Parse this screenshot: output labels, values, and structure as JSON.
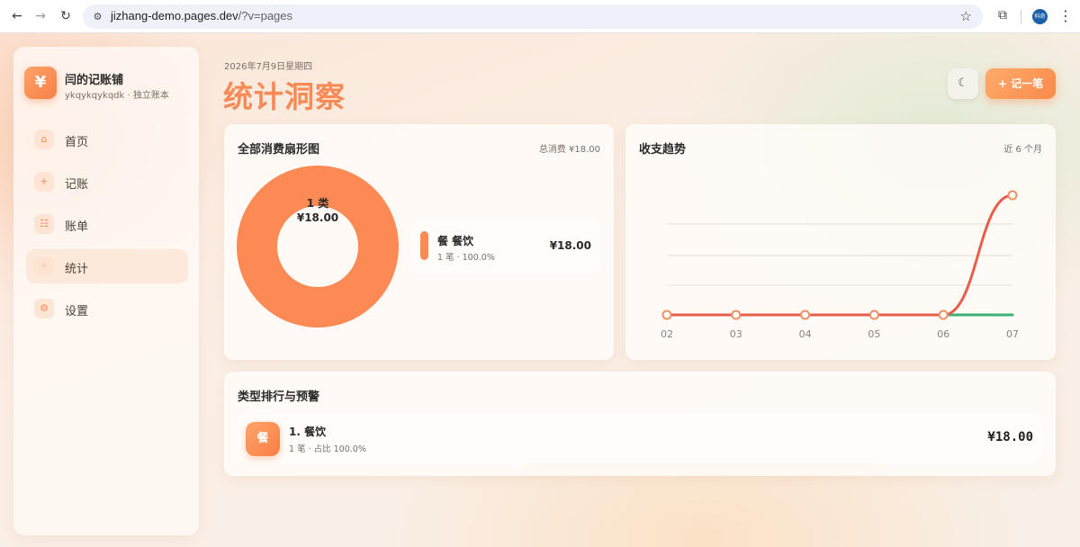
{
  "browser": {
    "url_host": "jizhang-demo.pages.dev",
    "url_path": "/?v=pages",
    "profile_label": "科奇"
  },
  "sidebar": {
    "logo_glyph": "¥",
    "brand_name": "闫的记账铺",
    "brand_sub": "ykqykqykqdk · 独立账本",
    "items": [
      {
        "label": "首页",
        "icon": "home-icon",
        "glyph": "⌂",
        "active": false
      },
      {
        "label": "记账",
        "icon": "plus-icon",
        "glyph": "+",
        "active": false
      },
      {
        "label": "账单",
        "icon": "list-icon",
        "glyph": "☷",
        "active": false
      },
      {
        "label": "统计",
        "icon": "stats-icon",
        "glyph": "◦",
        "active": true
      },
      {
        "label": "设置",
        "icon": "gear-icon",
        "glyph": "⚙",
        "active": false
      }
    ]
  },
  "header": {
    "date": "2026年7月9日星期四",
    "title": "统计洞察",
    "theme_glyph": "☾",
    "add_label": "+ 记一笔"
  },
  "pie_card": {
    "title": "全部消费扇形图",
    "meta": "总消费 ¥18.00",
    "center_line1": "1 类",
    "center_line2": "¥18.00",
    "legend": [
      {
        "name": "餐 餐饮",
        "sub": "1 笔 · 100.0%",
        "amount": "¥18.00",
        "color": "#fd8a54"
      }
    ]
  },
  "trend_card": {
    "title": "收支趋势",
    "meta": "近 6 个月"
  },
  "ranking_card": {
    "title": "类型排行与预警",
    "items": [
      {
        "badge": "餐",
        "name": "1. 餐饮",
        "sub": "1 笔 · 占比 100.0%",
        "amount": "¥18.00"
      }
    ]
  },
  "chart_data": [
    {
      "type": "pie",
      "categories": [
        "餐饮"
      ],
      "values": [
        18.0
      ],
      "colors": [
        "#fd8a54"
      ],
      "title": "全部消费扇形图"
    },
    {
      "type": "line",
      "title": "收支趋势",
      "x": [
        "02",
        "03",
        "04",
        "05",
        "06",
        "07"
      ],
      "series": [
        {
          "values": [
            0,
            0,
            0,
            0,
            0,
            18
          ],
          "color": "#e85d4a"
        },
        {
          "values": [
            0,
            0,
            0,
            0,
            0,
            0
          ],
          "color": "#3bb273"
        }
      ],
      "ylim": [
        0,
        18
      ],
      "grid": true
    }
  ]
}
